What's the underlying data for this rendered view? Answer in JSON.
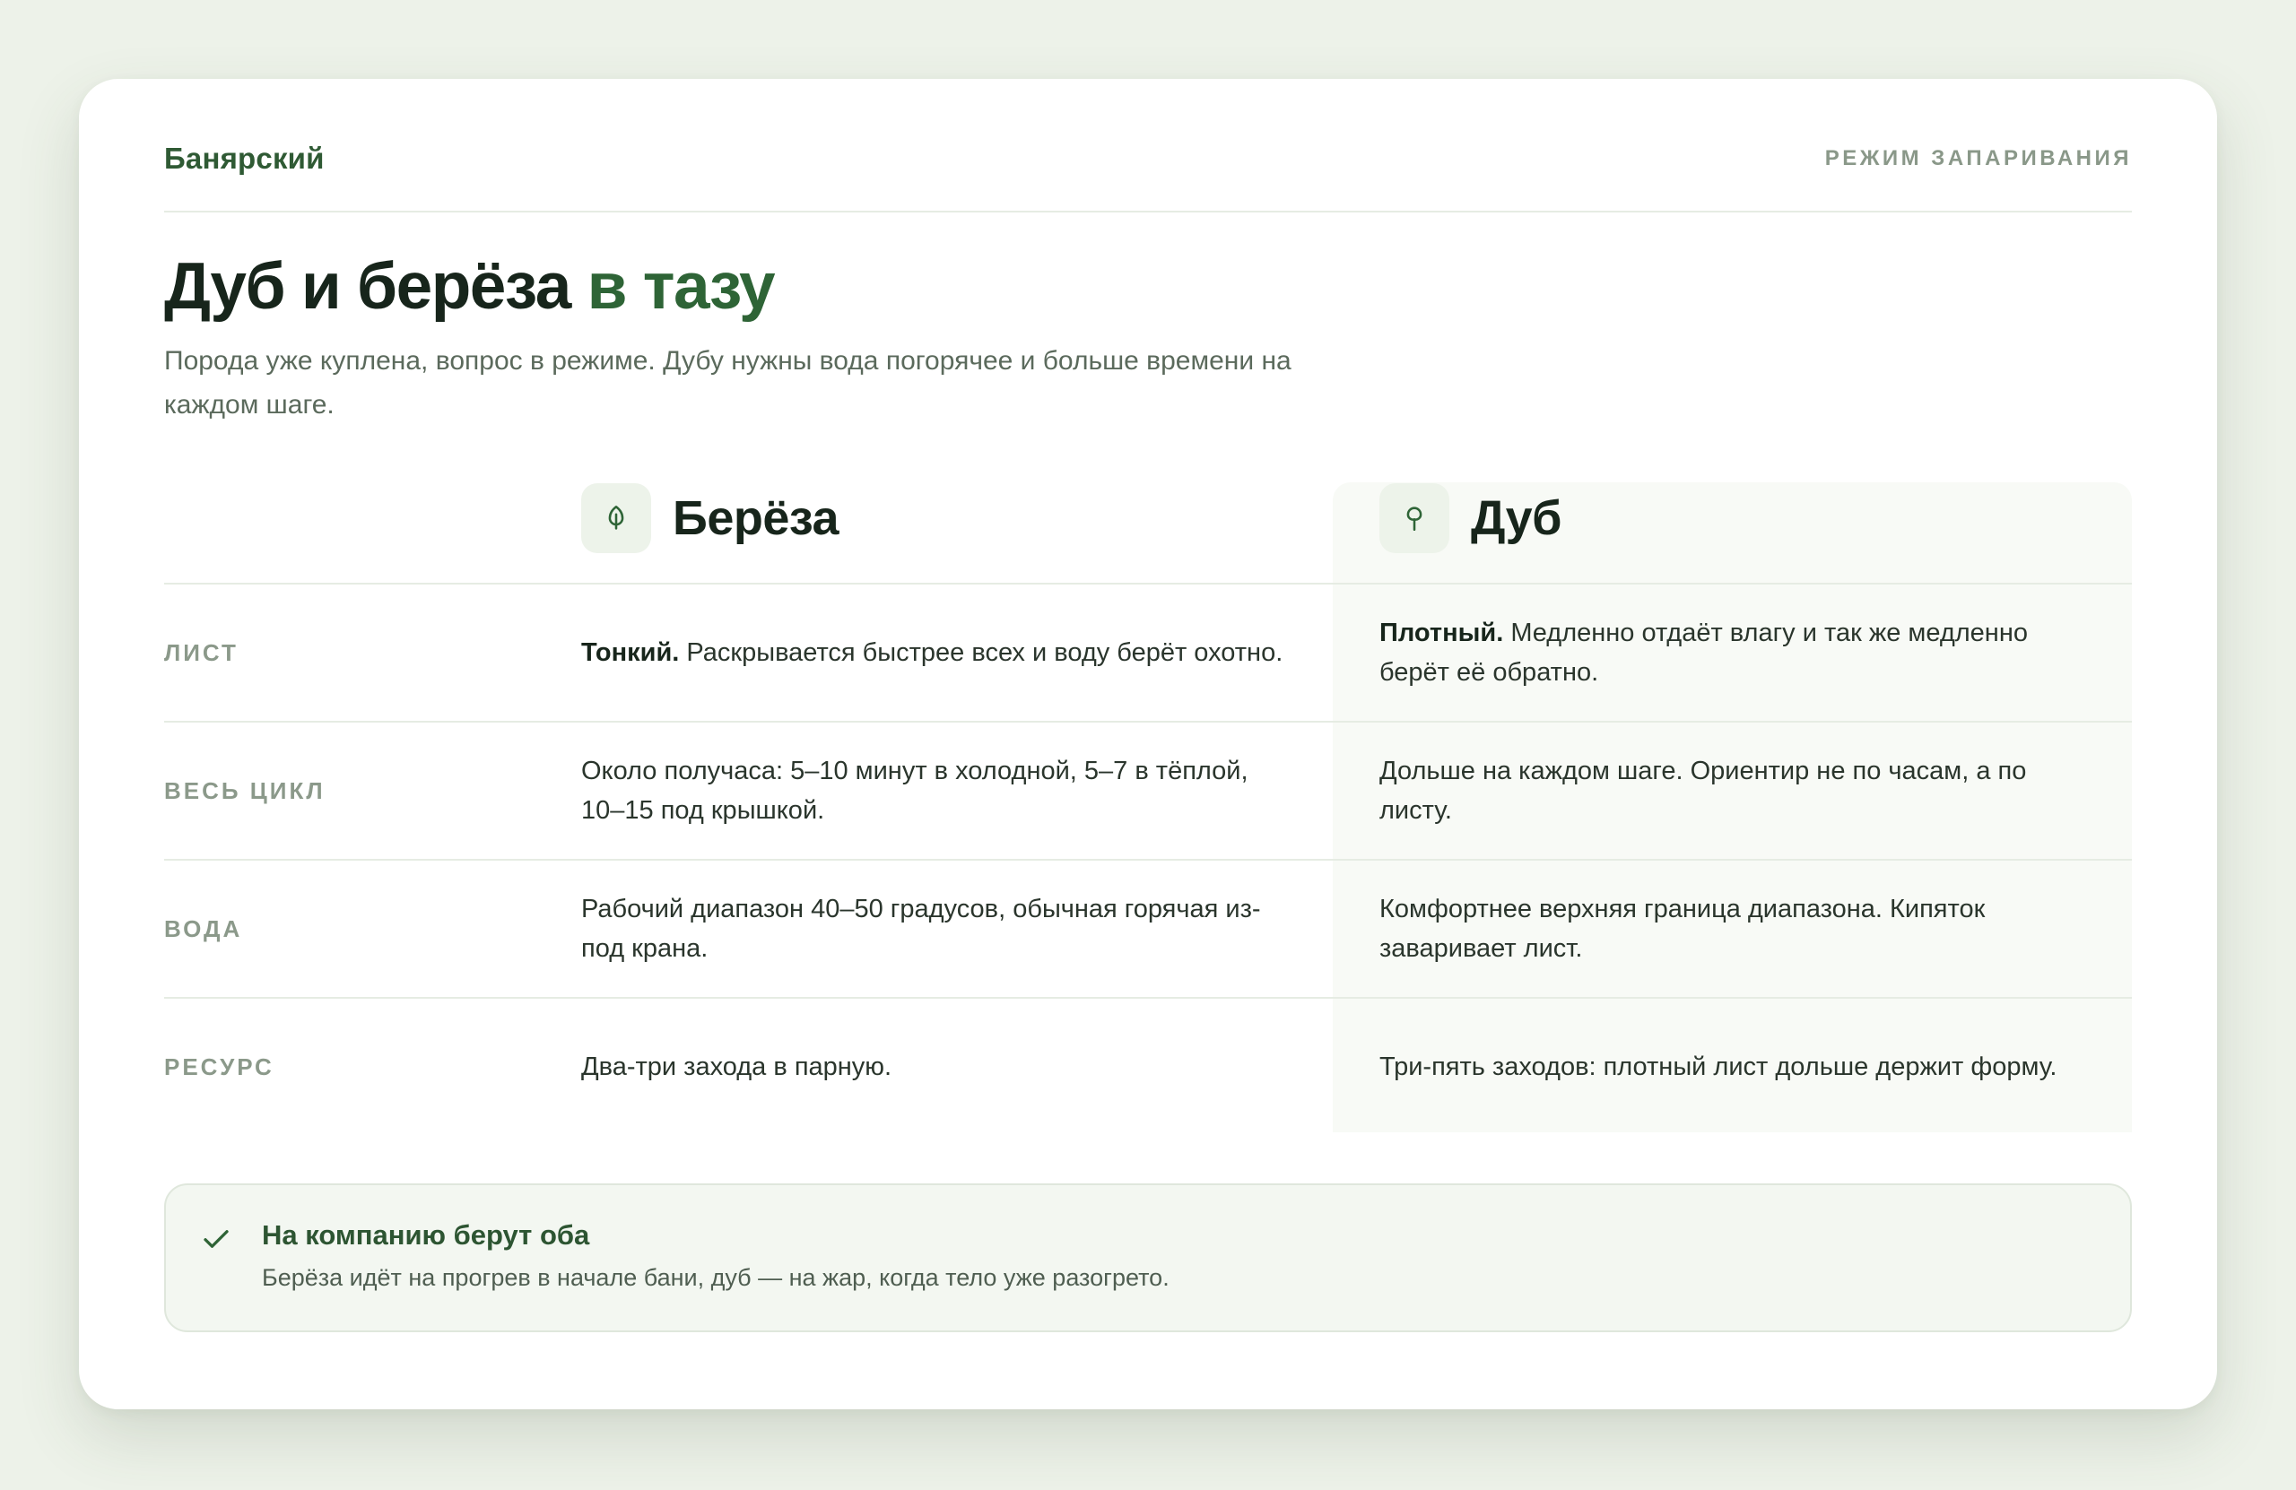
{
  "header": {
    "brand": "Банярский",
    "mode": "РЕЖИМ ЗАПАРИВАНИЯ"
  },
  "hero": {
    "title_main": "Дуб и берёза",
    "title_accent": "в тазу",
    "subtitle": "Порода уже куплена, вопрос в режиме. Дубу нужны вода погорячее и больше времени на каждом шаге."
  },
  "columns": {
    "birch": {
      "title": "Берёза",
      "icon": "leaf-icon"
    },
    "oak": {
      "title": "Дуб",
      "icon": "tree-icon"
    }
  },
  "rows": [
    {
      "label": "ЛИСТ",
      "birch_bold": "Тонкий.",
      "birch": "Раскрывается быстрее всех и воду берёт охотно.",
      "oak_bold": "Плотный.",
      "oak": "Медленно отдаёт влагу и так же медленно берёт её обратно."
    },
    {
      "label": "ВЕСЬ ЦИКЛ",
      "birch": "Около получаса: 5–10 минут в холодной, 5–7 в тёплой, 10–15 под крышкой.",
      "oak": "Дольше на каждом шаге. Ориентир не по часам, а по листу."
    },
    {
      "label": "ВОДА",
      "birch": "Рабочий диапазон 40–50 градусов, обычная горячая из-под крана.",
      "oak": "Комфортнее верхняя граница диапазона. Кипяток заваривает лист."
    },
    {
      "label": "РЕСУРС",
      "birch": "Два-три захода в парную.",
      "oak": "Три-пять заходов: плотный лист дольше держит форму."
    }
  ],
  "note": {
    "icon": "check-icon",
    "title": "На компанию берут оба",
    "text": "Берёза идёт на прогрев в начале бани, дуб — на жар, когда тело уже разогрето."
  },
  "colors": {
    "accent": "#2e6436",
    "background": "#edf2e9",
    "card": "#ffffff"
  }
}
